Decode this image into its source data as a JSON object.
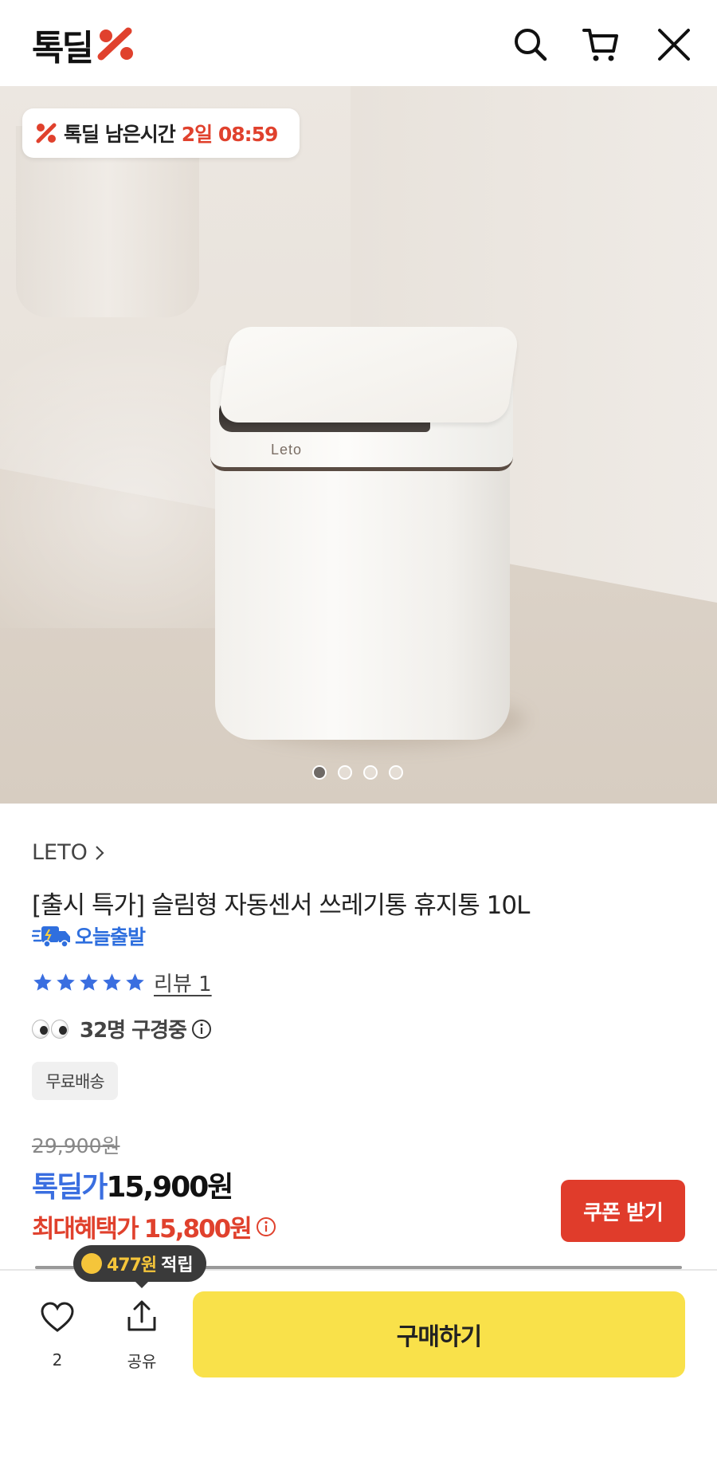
{
  "header": {
    "logo_text": "톡딜",
    "icons": [
      "search-icon",
      "cart-icon",
      "close-icon"
    ]
  },
  "hero": {
    "timer_label": "톡딜 남은시간",
    "timer_value": "2일 08:59",
    "product_brand_mark": "Leto",
    "carousel_total": 4,
    "carousel_active": 1
  },
  "product": {
    "brand": "LETO",
    "title": "[출시 특가] 슬림형 자동센서 쓰레기통 휴지통 10L",
    "ship_badge": "오늘출발",
    "rating": 5,
    "review_link": "리뷰 1",
    "viewers": "32명 구경중",
    "free_shipping": "무료배송",
    "original_price": "29,900원",
    "deal_label": "톡딜가",
    "deal_price": "15,900원",
    "max_benefit_label": "최대혜택가",
    "max_benefit_price": "15,800원",
    "coupon_button": "쿠폰 받기"
  },
  "bottom_bar": {
    "points_amount": "477원",
    "points_suffix": "적립",
    "like_count": "2",
    "share_label": "공유",
    "buy_button": "구매하기"
  },
  "colors": {
    "accent_red": "#e03c2b",
    "accent_blue": "#3a6ee0",
    "buy_yellow": "#f9e14a"
  }
}
